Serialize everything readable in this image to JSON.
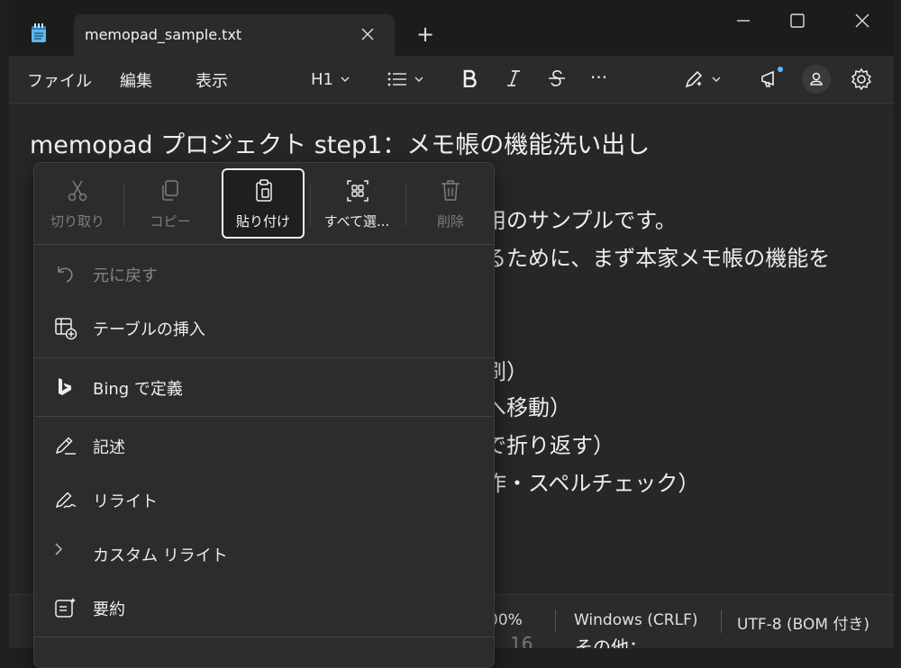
{
  "app": {
    "tab_title": "memopad_sample.txt",
    "new_tab_label": "+"
  },
  "menu": {
    "file": "ファイル",
    "edit": "編集",
    "view": "表示"
  },
  "format_toolbar": {
    "heading": "H1",
    "more": "···"
  },
  "document": {
    "title": "memopad プロジェクト step1：メモ帳の機能洗い出し",
    "fragments": [
      {
        "id": "l1",
        "text": "用のサンプルです。"
      },
      {
        "id": "l2",
        "text": "るために、まず本家メモ帳の機能を"
      },
      {
        "id": "l3",
        "text": "刷）"
      },
      {
        "id": "l4",
        "text": "へ移動）"
      },
      {
        "id": "l5",
        "text": "で折り返す）"
      },
      {
        "id": "l6",
        "text": "作・スペルチェック）"
      },
      {
        "id": "l7",
        "text": "16"
      },
      {
        "id": "l8",
        "text": "その他："
      }
    ]
  },
  "statusbar": {
    "zoom": "00%",
    "line_ending": "Windows (CRLF)",
    "encoding": "UTF-8 (BOM 付き)"
  },
  "context_menu": {
    "quick_actions": [
      {
        "id": "cut",
        "label": "切り取り",
        "state": "disabled"
      },
      {
        "id": "copy",
        "label": "コピー",
        "state": "disabled"
      },
      {
        "id": "paste",
        "label": "貼り付け",
        "state": "active"
      },
      {
        "id": "select_all",
        "label": "すべて選...",
        "state": "enabled"
      },
      {
        "id": "delete",
        "label": "削除",
        "state": "disabled"
      }
    ],
    "items": {
      "undo": "元に戻す",
      "insert_table": "テーブルの挿入",
      "bing_define": "Bing で定義",
      "write": "記述",
      "rewrite": "リライト",
      "custom_rewrite": "カスタム リライト",
      "summarize": "要約"
    }
  },
  "colors": {
    "background": "#272727",
    "menu_bg": "#2c2c2c",
    "notification_dot": "#4cc2ff"
  }
}
